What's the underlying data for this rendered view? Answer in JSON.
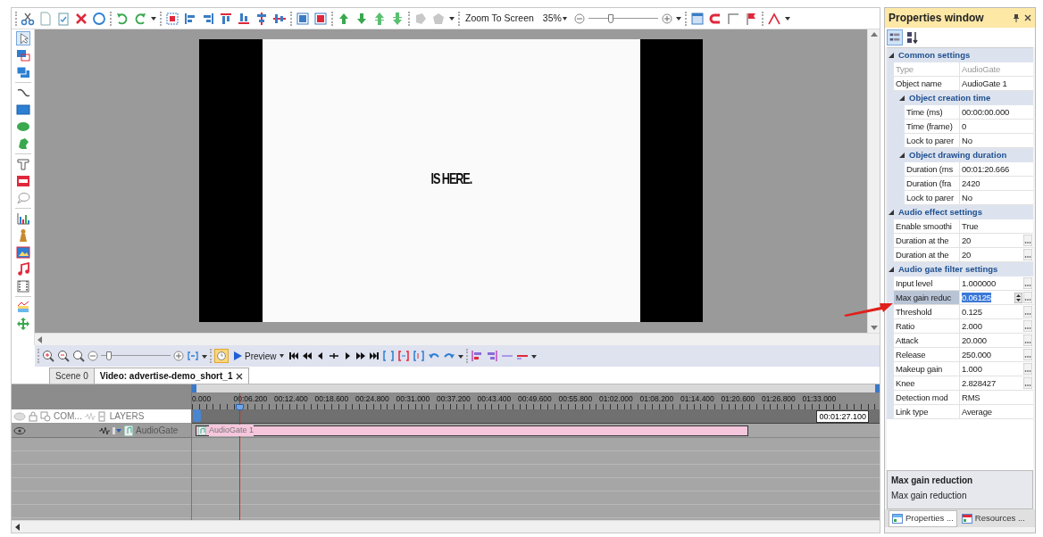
{
  "toolbar": {
    "zoom_button": "Zoom To Screen",
    "zoom_value": "35%",
    "zoom_slider": {
      "level": 0.32
    }
  },
  "preview": {
    "caption": "IS HERE."
  },
  "timeline_toolbar": {
    "zoom_slider": {
      "level": 0.12
    },
    "preview_button": "Preview",
    "clock_selected": true
  },
  "tabs": [
    {
      "label": "Scene 0",
      "selected": false
    },
    {
      "label": "Video: advertise-demo_short_1",
      "selected": true
    }
  ],
  "timeline": {
    "ruler_labels": [
      "0.000",
      "00:06.200",
      "00:12.400",
      "00:18.600",
      "00:24.800",
      "00:31.000",
      "00:37.200",
      "00:43.400",
      "00:49.600",
      "00:55.800",
      "01:02.000",
      "01:08.200",
      "01:14.400",
      "01:20.600",
      "01:26.800",
      "01:33.000"
    ],
    "column_header": "COM...",
    "layers_header": "LAYERS",
    "end_time": "00:01:27.100",
    "layers": [
      {
        "name": "AudioGate",
        "clip": "AudioGate 1"
      }
    ]
  },
  "properties": {
    "title": "Properties window",
    "groups": [
      {
        "title": "Common settings",
        "expanded": true,
        "children": [
          {
            "kind": "readonly",
            "name": "Type",
            "value": "AudioGate",
            "selected": false
          },
          {
            "kind": "text",
            "name": "Object name",
            "value": "AudioGate 1",
            "selected": false
          },
          {
            "kind": "group",
            "title": "Object creation time",
            "expanded": true,
            "children": [
              {
                "kind": "text",
                "name": "Time (ms)",
                "value": "00:00:00.000",
                "selected": false
              },
              {
                "kind": "text",
                "name": "Time (frame)",
                "value": "0",
                "selected": false
              },
              {
                "kind": "text",
                "name": "Lock to parer",
                "value": "No",
                "selected": false
              }
            ]
          },
          {
            "kind": "group",
            "title": "Object drawing duration",
            "expanded": true,
            "children": [
              {
                "kind": "text",
                "name": "Duration (ms",
                "value": "00:01:20.666",
                "selected": false
              },
              {
                "kind": "text",
                "name": "Duration (fra",
                "value": "2420",
                "selected": false
              },
              {
                "kind": "text",
                "name": "Lock to parer",
                "value": "No",
                "selected": false
              }
            ]
          }
        ]
      },
      {
        "title": "Audio effect settings",
        "expanded": true,
        "children": [
          {
            "kind": "text",
            "name": "Enable smoothi",
            "value": "True",
            "selected": false
          },
          {
            "kind": "ellipsis",
            "name": "Duration at the",
            "value": "20",
            "selected": false
          },
          {
            "kind": "ellipsis",
            "name": "Duration at the",
            "value": "20",
            "selected": false
          }
        ]
      },
      {
        "title": "Audio gate filter settings",
        "expanded": true,
        "children": [
          {
            "kind": "ellipsis",
            "name": "Input level",
            "value": "1.000000",
            "selected": false
          },
          {
            "kind": "spin",
            "name": "Max gain reduc",
            "value": "0.06125",
            "selected": true
          },
          {
            "kind": "ellipsis",
            "name": "Threshold",
            "value": "0.125",
            "selected": false
          },
          {
            "kind": "ellipsis",
            "name": "Ratio",
            "value": "2.000",
            "selected": false
          },
          {
            "kind": "ellipsis",
            "name": "Attack",
            "value": "20.000",
            "selected": false
          },
          {
            "kind": "ellipsis",
            "name": "Release",
            "value": "250.000",
            "selected": false
          },
          {
            "kind": "ellipsis",
            "name": "Makeup gain",
            "value": "1.000",
            "selected": false
          },
          {
            "kind": "ellipsis",
            "name": "Knee",
            "value": "2.828427",
            "selected": false
          },
          {
            "kind": "text",
            "name": "Detection mod",
            "value": "RMS",
            "selected": false
          },
          {
            "kind": "text",
            "name": "Link type",
            "value": "Average",
            "selected": false
          }
        ]
      }
    ],
    "description": {
      "title": "Max gain reduction",
      "text": "Max gain reduction"
    },
    "bottom_tabs": [
      {
        "label": "Properties ...",
        "selected": true
      },
      {
        "label": "Resources ...",
        "selected": false
      }
    ]
  }
}
